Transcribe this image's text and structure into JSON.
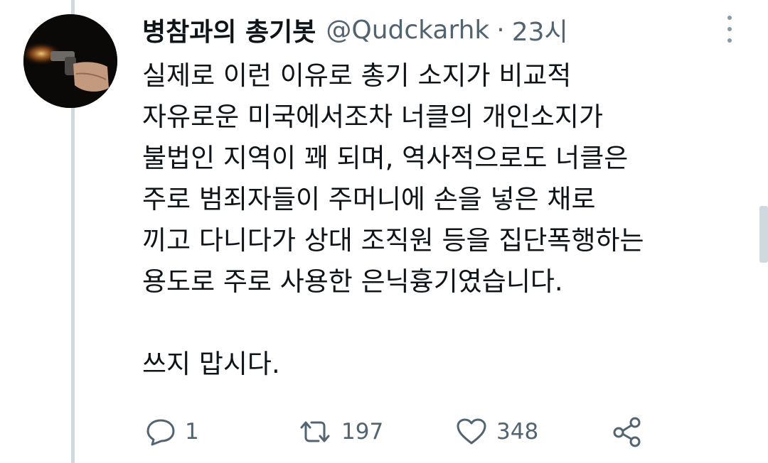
{
  "tweet": {
    "display_name": "병참과의 총기봇",
    "handle": "@Qudckarhk",
    "separator": "·",
    "time": "23시",
    "body_lines": [
      "실제로 이런 이유로 총기 소지가 비교적",
      "자유로운 미국에서조차 너클의 개인소지가",
      "불법인 지역이 꽤 되며, 역사적으로도 너클은",
      "주로 범죄자들이 주머니에 손을 넣은 채로",
      "끼고 다니다가 상대 조직원 등을 집단폭행하는",
      "용도로 주로 사용한 은닉흉기였습니다."
    ],
    "closing_line": "쓰지 맙시다.",
    "actions": {
      "reply_count": "1",
      "retweet_count": "197",
      "like_count": "348"
    }
  },
  "icons": {
    "reply": "reply-icon",
    "retweet": "retweet-icon",
    "like": "heart-icon",
    "share": "share-icon",
    "more": "more-vertical-icon"
  },
  "colors": {
    "text": "#0f1419",
    "secondary": "#536471",
    "thread_line": "#cfd9de"
  }
}
